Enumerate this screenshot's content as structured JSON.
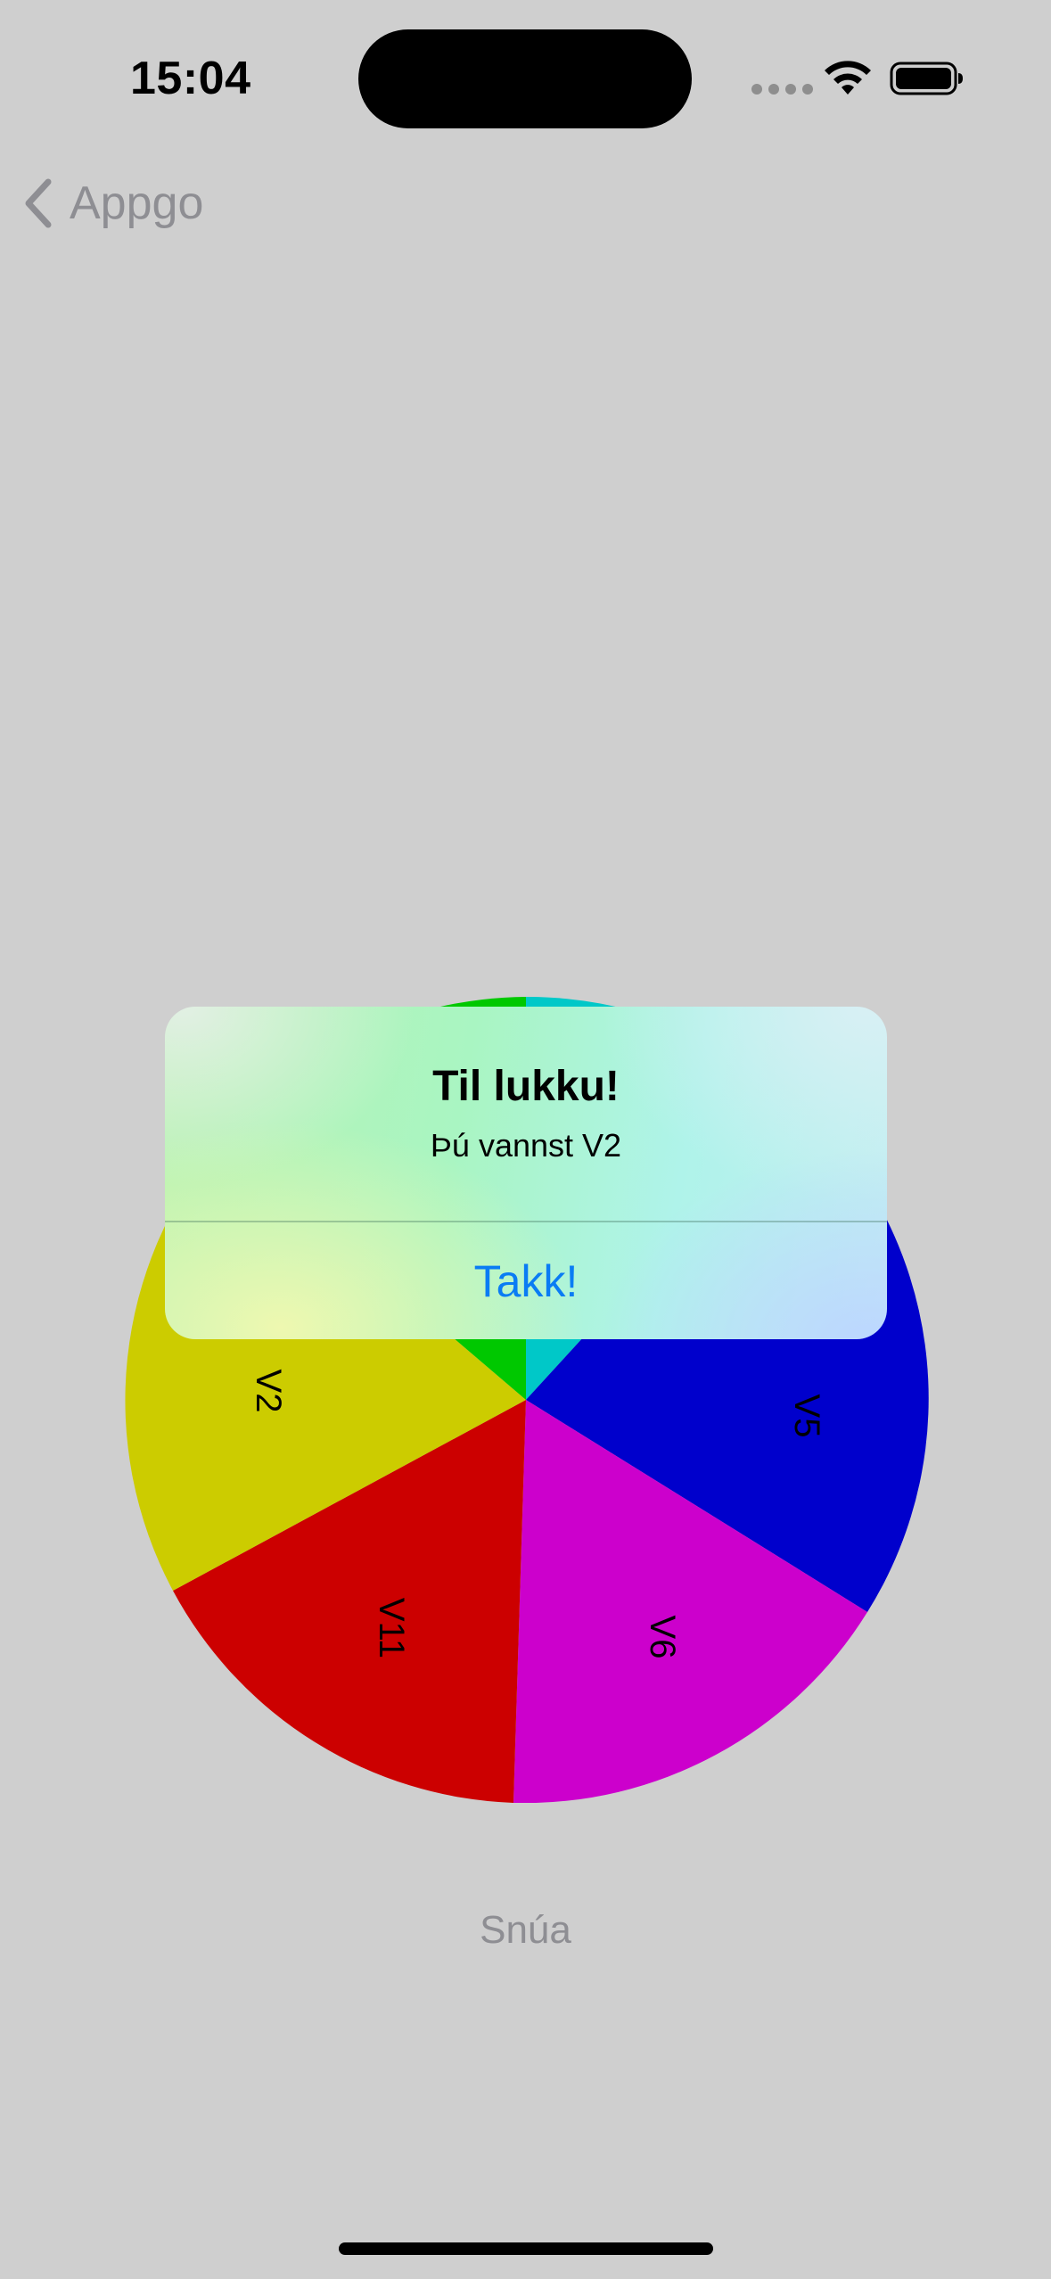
{
  "status_bar": {
    "time": "15:04",
    "icons": [
      "cellular-signal-icon",
      "wifi-icon",
      "battery-icon"
    ]
  },
  "nav": {
    "back_label": "Appgo",
    "back_icon": "chevron-left-icon"
  },
  "wheel": {
    "segments": [
      {
        "label": "",
        "color": "#00c8c8"
      },
      {
        "label": "",
        "color": "#0000cc"
      },
      {
        "label": "V5",
        "color": "#0000cc"
      },
      {
        "label": "V6",
        "color": "#cc00cc"
      },
      {
        "label": "V11",
        "color": "#cc0000"
      },
      {
        "label": "V2",
        "color": "#cccc00"
      },
      {
        "label": "",
        "color": "#00c800"
      }
    ]
  },
  "spin_button": {
    "label": "Snúa"
  },
  "alert": {
    "title": "Til lukku!",
    "message": "Þú vannst V2",
    "button_label": "Takk!"
  },
  "colors": {
    "background": "#cfcfcf",
    "accent": "#0a7cf4",
    "muted_text": "#8e8e93"
  }
}
